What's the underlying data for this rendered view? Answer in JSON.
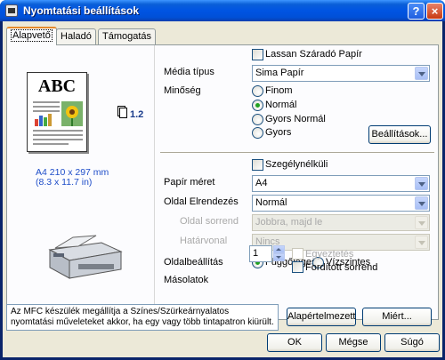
{
  "window": {
    "title": "Nyomtatási beállítások",
    "help_label": "?",
    "close_label": "×"
  },
  "tabs": [
    {
      "label": "Alapvető",
      "active": true
    },
    {
      "label": "Haladó",
      "active": false
    },
    {
      "label": "Támogatás",
      "active": false
    }
  ],
  "preview": {
    "abc_text": "ABC",
    "copies_value": "1.2",
    "paper_size_line1": "A4 210 x 297 mm",
    "paper_size_line2": "(8.3 x 11.7 in)"
  },
  "settings": {
    "slow_dry_label": "Lassan Száradó Papír",
    "slow_dry_checked": false,
    "media_type_label": "Média típus",
    "media_type_value": "Sima Papír",
    "quality_label": "Minőség",
    "quality_options": [
      "Finom",
      "Normál",
      "Gyors Normál",
      "Gyors"
    ],
    "quality_selected": "Normál",
    "settings_button": "Beállítások...",
    "borderless_label": "Szegélynélküli",
    "borderless_checked": false,
    "paper_size_label": "Papír méret",
    "paper_size_value": "A4",
    "page_layout_label": "Oldal Elrendezés",
    "page_layout_value": "Normál",
    "page_order_label": "Oldal sorrend",
    "page_order_value": "Jobbra, majd le",
    "border_line_label": "Határvonal",
    "border_line_value": "Nincs",
    "orientation_label": "Oldalbeállítás",
    "orientation_portrait": "Függőleges",
    "orientation_landscape": "Vízszintes",
    "orientation_selected": "Függőleges",
    "copies_label": "Másolatok",
    "copies_value": "1",
    "collate_label": "Egyeztetés",
    "reverse_order_label": "Fordított sorrend",
    "reverse_order_checked": false
  },
  "info": {
    "message": "Az MFC készülék megállítja a Színes/Szürkeárnyalatos nyomtatási műveleteket akkor, ha egy vagy több tintapatron kiürült."
  },
  "buttons": {
    "default": "Alapértelmezett",
    "why": "Miért...",
    "ok": "OK",
    "cancel": "Mégse",
    "help": "Súgó"
  },
  "colors": {
    "title_bar": "#0054e3",
    "dialog_bg": "#ece9d8",
    "paper_info_text": "#1f4ec9",
    "radio_selected": "#21a121"
  }
}
